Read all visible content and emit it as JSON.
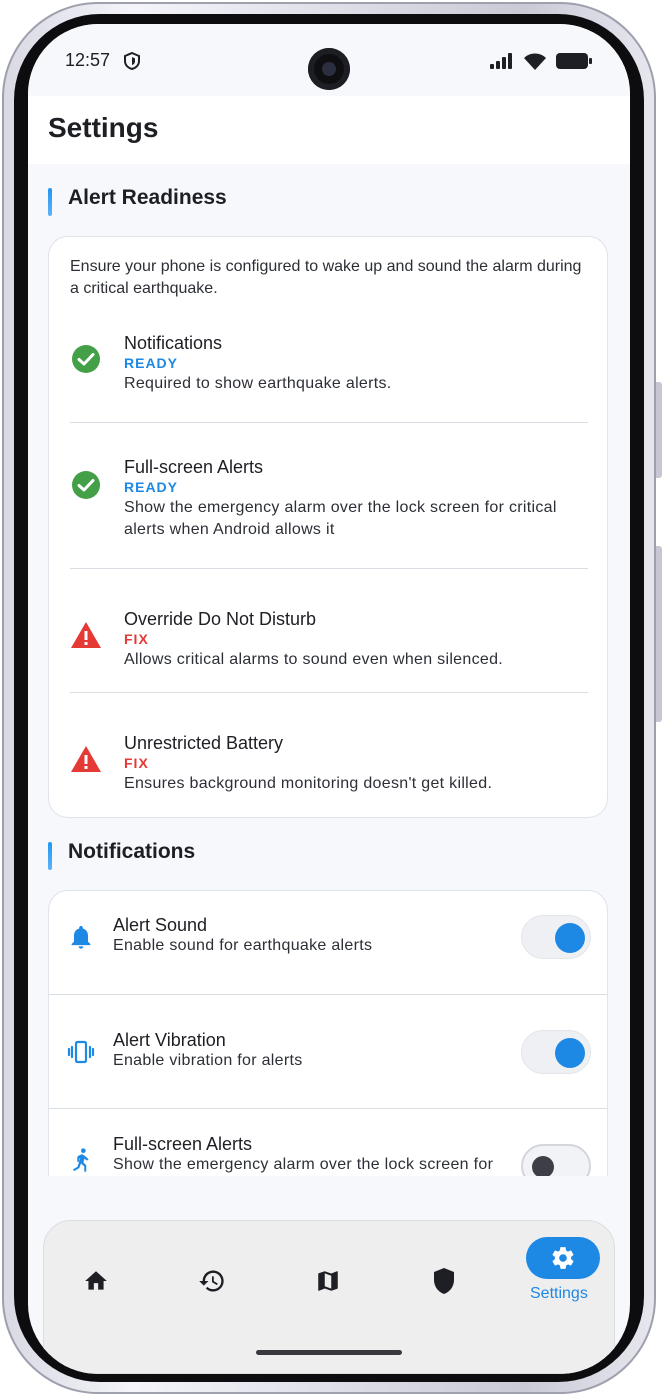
{
  "status": {
    "time": "12:57"
  },
  "app": {
    "title": "Settings"
  },
  "readiness": {
    "heading": "Alert Readiness",
    "intro": "Ensure your phone is configured to wake up and sound the alarm during a critical earthquake.",
    "items": [
      {
        "title": "Notifications",
        "status": "READY",
        "description": "Required to show earthquake alerts.",
        "icon": "check-circle-icon"
      },
      {
        "title": "Full-screen Alerts",
        "status": "READY",
        "description": "Show the emergency alarm over the lock screen for critical alerts when Android allows it",
        "icon": "check-circle-icon"
      },
      {
        "title": "Override Do Not Disturb",
        "status": "FIX",
        "description": "Allows critical alarms to sound even when silenced.",
        "icon": "warning-icon"
      },
      {
        "title": "Unrestricted Battery",
        "status": "FIX",
        "description": "Ensures background monitoring doesn't get killed.",
        "icon": "warning-icon"
      }
    ]
  },
  "notifications": {
    "heading": "Notifications",
    "rows": [
      {
        "title": "Alert Sound",
        "description": "Enable sound for earthquake alerts",
        "enabled": true,
        "icon": "bell-icon"
      },
      {
        "title": "Alert Vibration",
        "description": "Enable vibration for alerts",
        "enabled": true,
        "icon": "vibration-icon"
      },
      {
        "title": "Full-screen Alerts",
        "description": "Show the emergency alarm over the lock screen for",
        "enabled": false,
        "icon": "running-person-icon"
      }
    ]
  },
  "nav": {
    "items": [
      "home-icon",
      "history-icon",
      "map-icon",
      "shield-icon",
      "gear-icon"
    ],
    "active_label": "Settings"
  },
  "colors": {
    "accent": "#1e88e5",
    "ready": "#43a047",
    "fix": "#e53935"
  }
}
